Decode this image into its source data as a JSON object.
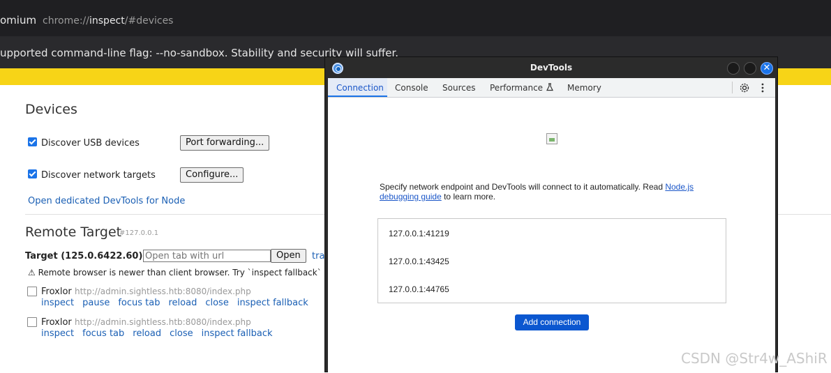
{
  "browser": {
    "app_name": "omium",
    "url_scheme": "chrome://",
    "url_host": "inspect",
    "url_hash": "/#devices"
  },
  "infobar": {
    "text": "upported command-line flag: --no-sandbox. Stability and security will suffer."
  },
  "devices": {
    "heading": "Devices",
    "usb_label": "Discover USB devices",
    "port_forwarding_button": "Port forwarding...",
    "network_label": "Discover network targets",
    "configure_button": "Configure...",
    "node_link": "Open dedicated DevTools for Node"
  },
  "remote_target": {
    "heading": "Remote Target",
    "host": "#127.0.0.1",
    "target_label": "Target (125.0.6422.60)",
    "url_placeholder": "Open tab with url",
    "open_button": "Open",
    "trace_link": "trac",
    "warning": "⚠ Remote browser is newer than client browser. Try `inspect fallback` if in",
    "targets": [
      {
        "name": "Froxlor",
        "url": "http://admin.sightless.htb:8080/index.php",
        "actions": [
          "inspect",
          "pause",
          "focus tab",
          "reload",
          "close",
          "inspect fallback"
        ]
      },
      {
        "name": "Froxlor",
        "url": "http://admin.sightless.htb:8080/index.php",
        "actions": [
          "inspect",
          "focus tab",
          "reload",
          "close",
          "inspect fallback"
        ]
      }
    ]
  },
  "devtools": {
    "title": "DevTools",
    "tabs": [
      "Connection",
      "Console",
      "Sources",
      "Performance",
      "Memory"
    ],
    "perf_icon": "flask-icon",
    "description_pre": "Specify network endpoint and DevTools will connect to it automatically. Read ",
    "description_link": "Node.js debugging guide",
    "description_post": " to learn more.",
    "connections": [
      "127.0.0.1:41219",
      "127.0.0.1:43425",
      "127.0.0.1:44765"
    ],
    "add_button": "Add connection",
    "close_glyph": "✕"
  },
  "watermark": "CSDN @Str4w_AShiR"
}
